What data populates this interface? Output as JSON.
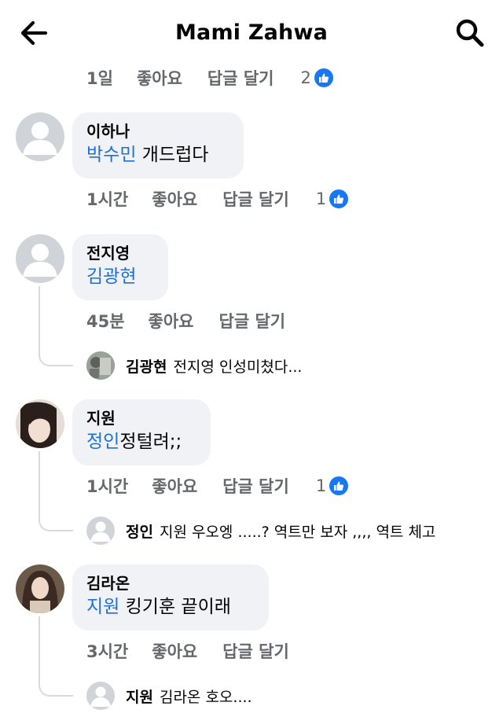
{
  "header": {
    "title": "Mami Zahwa",
    "back_icon": "arrow-left-icon",
    "search_icon": "search-icon"
  },
  "labels": {
    "like": "좋아요",
    "reply": "답글 달기"
  },
  "colors": {
    "tag_blue": "#216fdb",
    "like_blue": "#1877f2",
    "meta_gray": "#65676b",
    "bubble_bg": "#f0f2f5"
  },
  "top_meta": {
    "time": "1일",
    "reactions": "2"
  },
  "comments": [
    {
      "author": "이하나",
      "tag": "박수민",
      "text": " 개드럽다",
      "time": "1시간",
      "reactions": "1"
    },
    {
      "author": "전지영",
      "tag": "김광현",
      "text": "",
      "time": "45분",
      "reply": {
        "author": "김광현",
        "text": "전지영 인성미쳤다..."
      }
    },
    {
      "author": "지원",
      "tag": "정인",
      "text": "정털려;;",
      "time": "1시간",
      "reactions": "1",
      "reply": {
        "author": "정인",
        "text": "지원 우오엥 .....? 역트만 보자 ,,,, 역트 체고"
      }
    },
    {
      "author": "김라온",
      "tag": "지원",
      "text": " 킹기훈 끝이래",
      "time": "3시간",
      "reply": {
        "author": "지원",
        "text": "김라온 호오...."
      }
    }
  ]
}
